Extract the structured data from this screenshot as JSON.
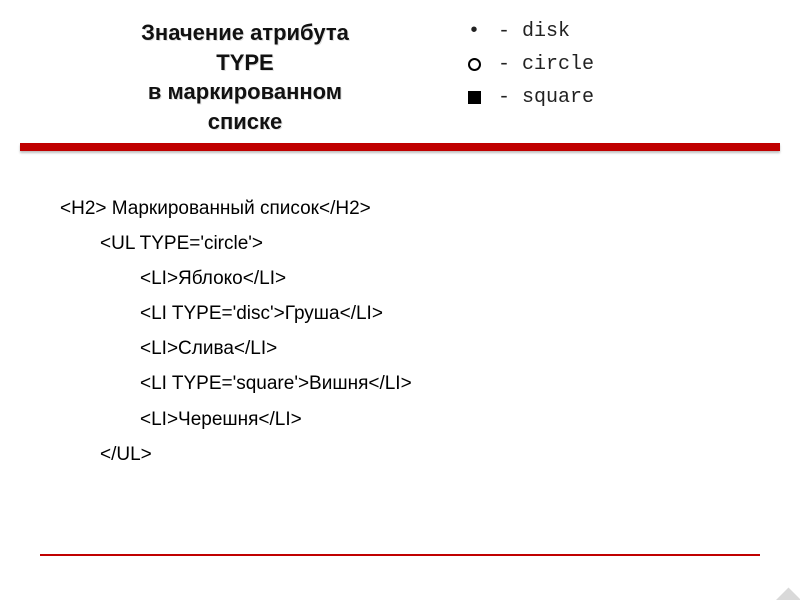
{
  "title": {
    "line1": "Значение атрибута",
    "line2": "TYPE",
    "line3": "в маркированном",
    "line4": "списке"
  },
  "legend": {
    "disk": "- disk",
    "circle": "- circle",
    "square": "- square"
  },
  "code": {
    "l1": "<H2> Маркированный список</H2>",
    "l2": "<UL TYPE='circle'>",
    "l3": "<LI>Яблоко</LI>",
    "l4": "<LI TYPE='disc'>Груша</LI>",
    "l5": "<LI>Слива</LI>",
    "l6": "<LI TYPE='square'>Вишня</LI>",
    "l7": "<LI>Черешня</LI>",
    "l8": "</UL>"
  }
}
